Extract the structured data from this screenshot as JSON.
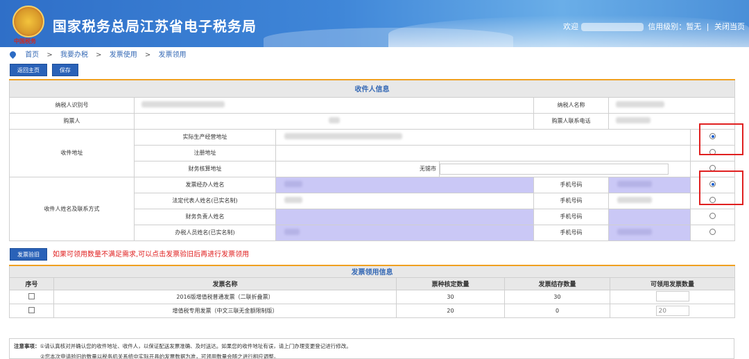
{
  "header": {
    "emblem_sub": "中国税务",
    "title": "国家税务总局江苏省电子税务局",
    "welcome": "欢迎",
    "credit_level": "信用级别：暂无",
    "divider": "|",
    "close": "关闭当页"
  },
  "breadcrumb": [
    "首页",
    "我要办税",
    "发票使用",
    "发票领用"
  ],
  "breadcrumb_sep": ">",
  "buttons": {
    "home": "返回主页",
    "save": "保存",
    "verify": "发票验旧"
  },
  "recipient": {
    "section_title": "收件人信息",
    "taxpayer_id_label": "纳税人识别号",
    "taxpayer_name_label": "纳税人名称",
    "buyer_label": "购票人",
    "buyer_phone_label": "购票人联系电话",
    "address_group_label": "收件地址",
    "addr_actual": "实际生产经营地址",
    "addr_registered": "注册地址",
    "addr_finance": "财务核算地址",
    "addr_finance_city": "无锡市",
    "contact_group_label": "收件人姓名及联系方式",
    "contact_invoice_agent": "发票经办人姓名",
    "contact_legal_rep": "法定代表人姓名(已实名制)",
    "contact_finance": "财务负责人姓名",
    "contact_tax_staff": "办税人员姓名(已实名制)",
    "phone_label": "手机号码"
  },
  "verify_note": "如果可领用数量不满足需求,可以点击发票验旧后再进行发票领用",
  "invoice": {
    "section_title": "发票领用信息",
    "columns": [
      "序号",
      "发票名称",
      "票种核定数量",
      "发票结存数量",
      "可领用发票数量"
    ],
    "rows": [
      {
        "name": "2016版增值税普通发票（二联折叠票）",
        "approved": "30",
        "stock": "30",
        "qty": ""
      },
      {
        "name": "增值税专用发票（中文三联无金额限制版）",
        "approved": "20",
        "stock": "0",
        "qty": "20"
      }
    ]
  },
  "notes": {
    "label": "注意事项：",
    "line1": "①请认真核对并确认您的收件地址、收件人，以保证配送发票准确、及时送达。如果您的收件地址有误，请上门办理变更登记进行修改。",
    "line2": "②您本次申请验旧的数量以税务机关系统中实际开具的发票数据为准，可领用数量会随之进行相应调整。"
  },
  "colors": {
    "accent": "#2a62b8",
    "highlight": "#e02020",
    "purple_field": "#cac8f6",
    "section_border": "#f0a020"
  }
}
